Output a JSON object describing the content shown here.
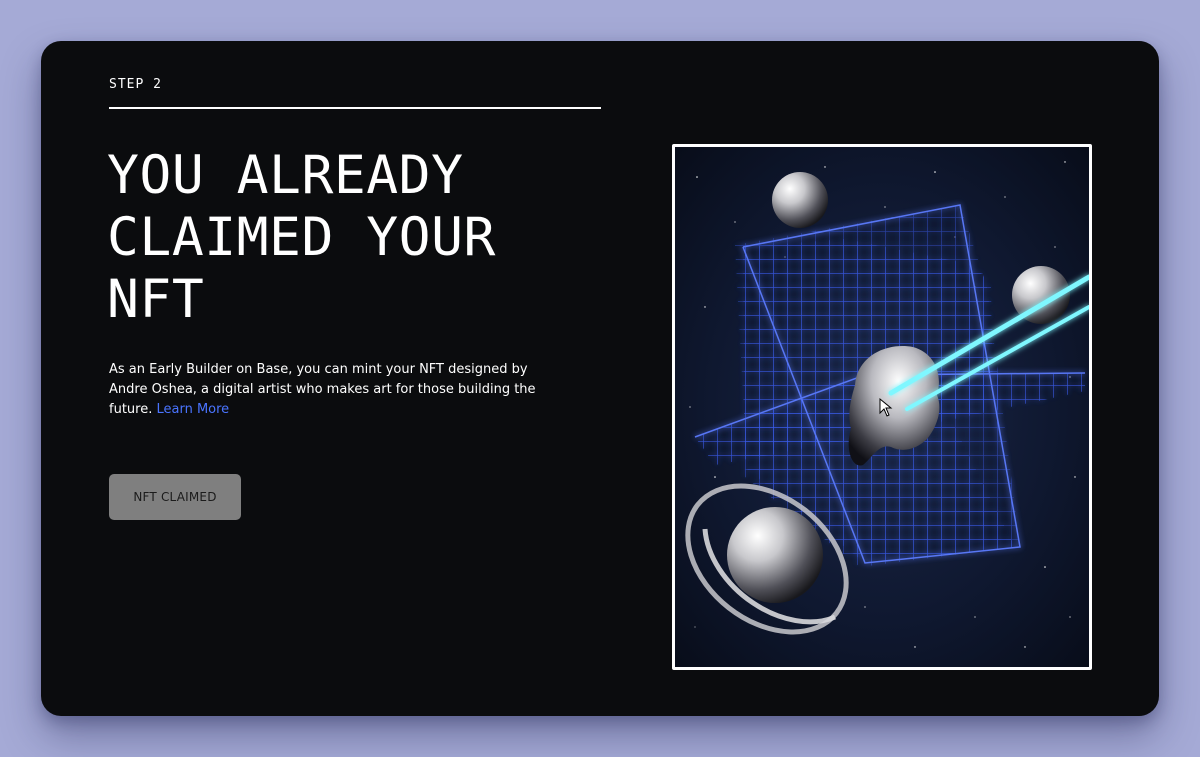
{
  "step_label": "STEP 2",
  "headline": {
    "line1": "YOU ALREADY",
    "line2": "CLAIMED YOUR",
    "line3": "NFT"
  },
  "description": {
    "text": "As an Early Builder on Base, you can mint your NFT designed by Andre Oshea, a digital artist who makes art for those building the future.",
    "link_text": "Learn More"
  },
  "claim_button_label": "NFT CLAIMED",
  "colors": {
    "page_background": "#a5aad6",
    "card_background": "#0b0c0e",
    "link": "#4a74ff",
    "button_disabled": "#7f7f7f",
    "grid_blue": "#3a5cff",
    "laser_cyan": "#7ff7ff"
  },
  "icons": {
    "cursor": "mouse-pointer-icon"
  }
}
